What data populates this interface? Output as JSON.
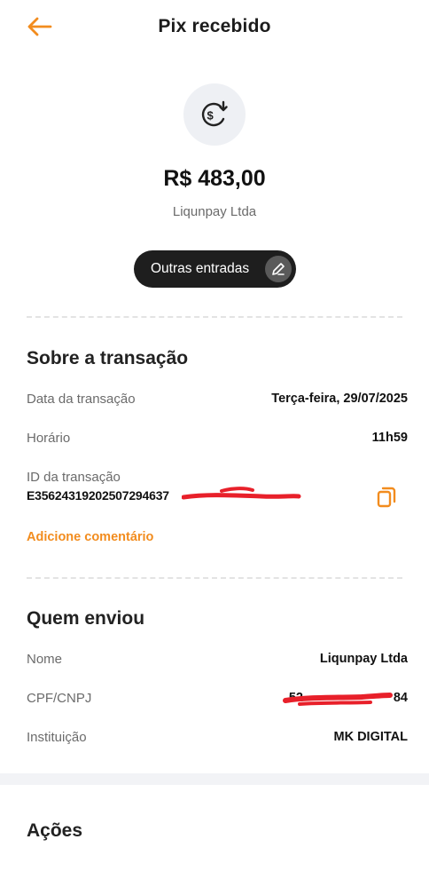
{
  "header": {
    "title": "Pix recebido",
    "back_icon": "arrow-left-icon"
  },
  "summary": {
    "icon": "money-receive-icon",
    "amount": "R$ 483,00",
    "counterparty": "Liqunpay Ltda",
    "category_label": "Outras entradas",
    "category_edit_icon": "pencil-icon"
  },
  "transaction": {
    "title": "Sobre a transação",
    "date_label": "Data da transação",
    "date_value": "Terça-feira, 29/07/2025",
    "time_label": "Horário",
    "time_value": "11h59",
    "id_label": "ID da transação",
    "id_value": "E35624319202507294637",
    "copy_icon": "copy-icon",
    "add_comment": "Adicione comentário"
  },
  "sender": {
    "title": "Quem enviou",
    "name_label": "Nome",
    "name_value": "Liqunpay Ltda",
    "doc_label": "CPF/CNPJ",
    "doc_value": "52",
    "doc_value_end": "84",
    "institution_label": "Instituição",
    "institution_value": "MK DIGITAL"
  },
  "actions": {
    "title": "Ações"
  },
  "colors": {
    "accent": "#f28c1e",
    "redaction": "#e8202a",
    "pill": "#1e1e1e"
  }
}
